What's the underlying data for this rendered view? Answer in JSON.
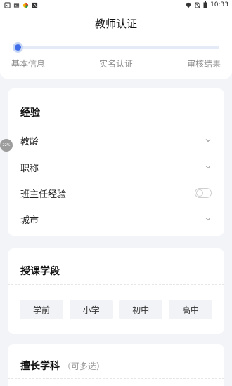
{
  "status_bar": {
    "time": "10:33",
    "left_icons": [
      "gallery-icon",
      "image-icon",
      "app-icon",
      "font-icon"
    ],
    "right_icons": [
      "wifi-icon",
      "no-sim-icon",
      "battery-icon"
    ]
  },
  "header": {
    "title": "教师认证"
  },
  "progress": {
    "steps": [
      "基本信息",
      "实名认证",
      "审核结果"
    ],
    "current_step": 0,
    "accent_color": "#3f6ee8"
  },
  "experience": {
    "title": "经验",
    "rows": [
      {
        "label": "教龄",
        "control": "dropdown"
      },
      {
        "label": "职称",
        "control": "dropdown"
      },
      {
        "label": "班主任经验",
        "control": "toggle",
        "value": false
      },
      {
        "label": "城市",
        "control": "dropdown"
      }
    ]
  },
  "teaching_stage": {
    "title": "授课学段",
    "options": [
      "学前",
      "小学",
      "初中",
      "高中"
    ]
  },
  "subjects": {
    "title": "擅长学科",
    "hint": "（可多选）"
  },
  "floating_badge": {
    "text": "22%"
  }
}
